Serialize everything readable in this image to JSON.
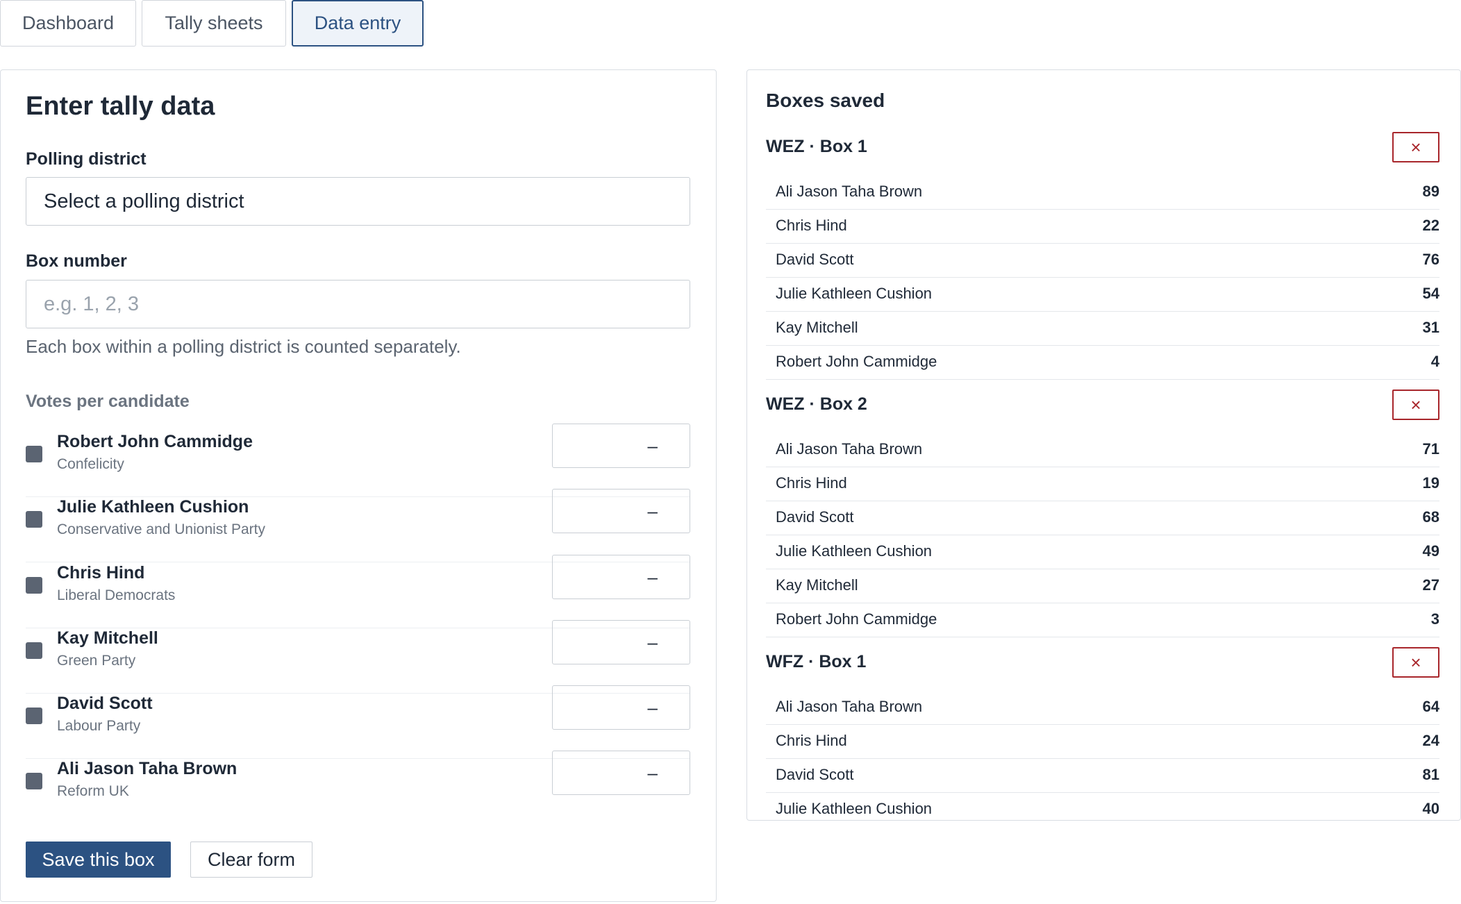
{
  "tabs": [
    {
      "label": "Dashboard"
    },
    {
      "label": "Tally sheets"
    },
    {
      "label": "Data entry",
      "active": true
    }
  ],
  "form": {
    "title": "Enter tally data",
    "district_label": "Polling district",
    "district_value": "Select a polling district",
    "box_label": "Box number",
    "box_placeholder": "e.g. 1, 2, 3",
    "box_help": "Each box within a polling district is counted separately.",
    "votes_label": "Votes per candidate",
    "candidates": [
      {
        "name": "Robert John Cammidge",
        "party": "Confelicity",
        "vote": "–"
      },
      {
        "name": "Julie Kathleen Cushion",
        "party": "Conservative and Unionist Party",
        "vote": "–"
      },
      {
        "name": "Chris Hind",
        "party": "Liberal Democrats",
        "vote": "–"
      },
      {
        "name": "Kay Mitchell",
        "party": "Green Party",
        "vote": "–"
      },
      {
        "name": "David Scott",
        "party": "Labour Party",
        "vote": "–"
      },
      {
        "name": "Ali Jason Taha Brown",
        "party": "Reform UK",
        "vote": "–"
      }
    ],
    "save_label": "Save this box",
    "clear_label": "Clear form"
  },
  "saved": {
    "title": "Boxes saved",
    "delete_glyph": "×",
    "boxes": [
      {
        "title": "WEZ · Box 1",
        "rows": [
          {
            "name": "Ali Jason Taha Brown",
            "votes": "89"
          },
          {
            "name": "Chris Hind",
            "votes": "22"
          },
          {
            "name": "David Scott",
            "votes": "76"
          },
          {
            "name": "Julie Kathleen Cushion",
            "votes": "54"
          },
          {
            "name": "Kay Mitchell",
            "votes": "31"
          },
          {
            "name": "Robert John Cammidge",
            "votes": "4"
          }
        ]
      },
      {
        "title": "WEZ · Box 2",
        "rows": [
          {
            "name": "Ali Jason Taha Brown",
            "votes": "71"
          },
          {
            "name": "Chris Hind",
            "votes": "19"
          },
          {
            "name": "David Scott",
            "votes": "68"
          },
          {
            "name": "Julie Kathleen Cushion",
            "votes": "49"
          },
          {
            "name": "Kay Mitchell",
            "votes": "27"
          },
          {
            "name": "Robert John Cammidge",
            "votes": "3"
          }
        ]
      },
      {
        "title": "WFZ · Box 1",
        "rows": [
          {
            "name": "Ali Jason Taha Brown",
            "votes": "64"
          },
          {
            "name": "Chris Hind",
            "votes": "24"
          },
          {
            "name": "David Scott",
            "votes": "81"
          },
          {
            "name": "Julie Kathleen Cushion",
            "votes": "40"
          }
        ]
      }
    ]
  },
  "colors": {
    "accent": "#2c5282",
    "danger": "#a8262b",
    "swatch": "#5b6472"
  }
}
